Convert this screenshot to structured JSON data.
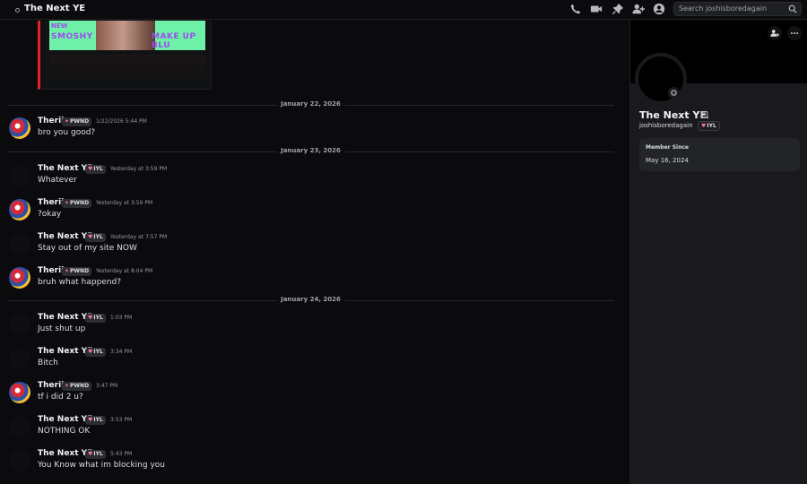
{
  "topbar": {
    "title": "The Next YE",
    "search_placeholder": "Search joshisboredagain",
    "icons": [
      "voice-call-icon",
      "video-call-icon",
      "pin-icon",
      "add-friends-icon",
      "user-profile-icon",
      "search-icon"
    ]
  },
  "embed": {
    "line1": "NEW",
    "line2": "SMOSHY",
    "line3": "MAKE UP BLU"
  },
  "dividers": [
    "January 22, 2026",
    "January 23, 2026",
    "January 24, 2026"
  ],
  "messages": [
    {
      "author": "Therii",
      "tag": "PWND",
      "time": "1/22/2026 5:44 PM",
      "text": "bro you good?"
    },
    {
      "author": "The Next YE",
      "tag": "IYL",
      "time": "Yesterday at 3:59 PM",
      "text": "Whatever"
    },
    {
      "author": "Therii",
      "tag": "PWND",
      "time": "Yesterday at 3:59 PM",
      "text": "?okay"
    },
    {
      "author": "The Next YE",
      "tag": "IYL",
      "time": "Yesterday at 7:57 PM",
      "text": "Stay out of my site NOW"
    },
    {
      "author": "Therii",
      "tag": "PWND",
      "time": "Yesterday at 8:04 PM",
      "text": "bruh what happend?"
    },
    {
      "author": "The Next YE",
      "tag": "IYL",
      "time": "1:03 PM",
      "text": "Just shut up"
    },
    {
      "author": "The Next YE",
      "tag": "IYL",
      "time": "3:34 PM",
      "text": "Bitch"
    },
    {
      "author": "Therii",
      "tag": "PWND",
      "time": "3:47 PM",
      "text": "tf i did 2 u?"
    },
    {
      "author": "The Next YE",
      "tag": "IYL",
      "time": "3:53 PM",
      "text": "NOTHING OK"
    },
    {
      "author": "The Next YE",
      "tag": "IYL",
      "time": "5:43 PM",
      "text": "You Know what im blocking you"
    }
  ],
  "profile": {
    "display_name": "The Next YE",
    "username": "joshisboredagain",
    "tag": "IYL",
    "member_since_label": "Member Since",
    "member_since_value": "May 16, 2024",
    "status": "offline"
  },
  "colors": {
    "background": "#0b0b0d",
    "panel": "#1a1a1e",
    "embed_border": "#e02424",
    "embed_image": "#6ff0a8"
  }
}
